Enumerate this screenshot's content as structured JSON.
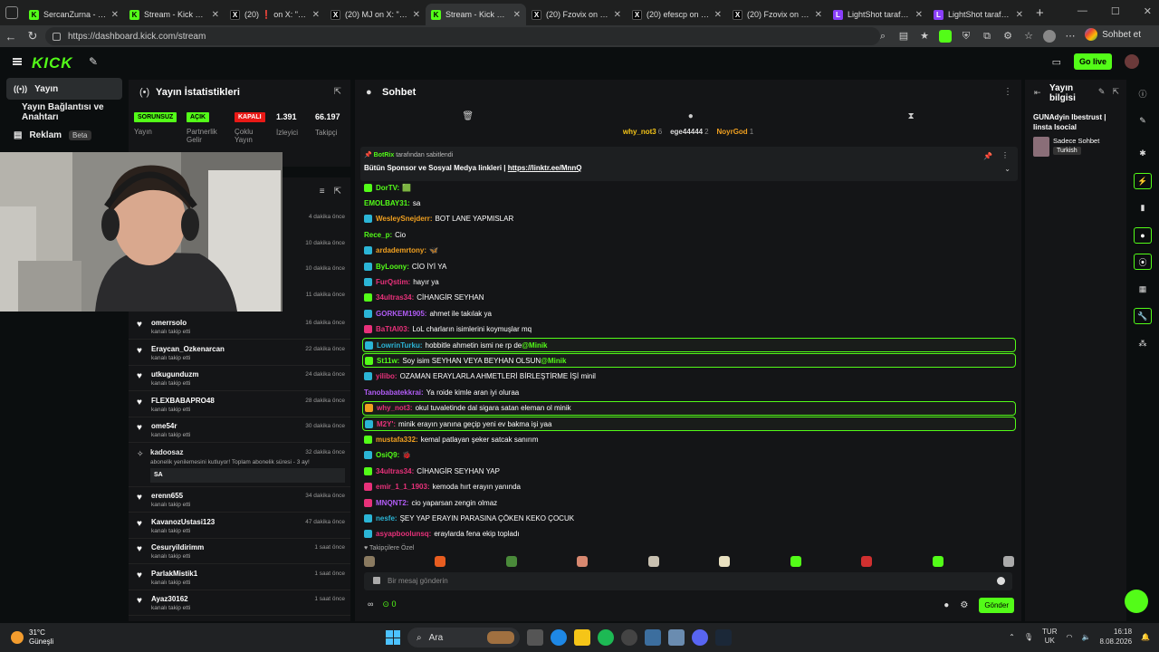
{
  "browser": {
    "tabs": [
      {
        "label": "SercanZurna - Watch",
        "fav": "K",
        "type": "k"
      },
      {
        "label": "Stream - Kick Dashb",
        "fav": "K",
        "type": "k"
      },
      {
        "label": "(20) ❗ on X: \"Raaa",
        "fav": "X",
        "type": "x"
      },
      {
        "label": "(20) MJ on X: \"Selam",
        "fav": "X",
        "type": "x"
      },
      {
        "label": "Stream - Kick Dashb",
        "fav": "K",
        "type": "k",
        "active": true
      },
      {
        "label": "(20) Fzovix on X: \"E",
        "fav": "X",
        "type": "x"
      },
      {
        "label": "(20) efescp on X: \"G",
        "fav": "X",
        "type": "x"
      },
      {
        "label": "(20) Fzovix on X: \"Ka",
        "fav": "X",
        "type": "x"
      },
      {
        "label": "LightShot tarafından",
        "fav": "L",
        "type": "l"
      },
      {
        "label": "LightShot tarafından",
        "fav": "L",
        "type": "l"
      }
    ],
    "url": "https://dashboard.kick.com/stream",
    "profile_label": "Sohbet et",
    "new_tab": "+",
    "win_controls": [
      "—",
      "☐",
      "✕"
    ]
  },
  "header": {
    "logo": "KICK",
    "go_live": "Go live"
  },
  "leftnav": {
    "items": [
      {
        "label": "Yayın",
        "icon": "broadcast-icon"
      },
      {
        "label": "Yayın Bağlantısı ve Anahtarı",
        "icon": ""
      },
      {
        "label": "Reklam",
        "icon": "ad-icon",
        "badge": "Beta"
      }
    ]
  },
  "stats": {
    "title": "Yayın İstatistikleri",
    "items": [
      {
        "badge": "SORUNSUZ",
        "label": "Yayın",
        "color": "#53fc18"
      },
      {
        "badge": "AÇIK",
        "label": "Partnerlik Gelir",
        "color": "#53fc18"
      },
      {
        "badge": "KAPALI",
        "label": "Çoklu Yayın",
        "color": "#e91916"
      },
      {
        "value": "1.391",
        "label": "İzleyici"
      },
      {
        "value": "66.197",
        "label": "Takipçi"
      }
    ]
  },
  "activity": {
    "top_times": [
      "4 dakika önce",
      "10 dakika önce",
      "10 dakika önce",
      "11 dakika önce"
    ],
    "rows": [
      {
        "name": "omerrsolo",
        "sub": "kanalı takip etti",
        "time": "16 dakika önce"
      },
      {
        "name": "Eraycan_Ozkenarcan",
        "sub": "kanalı takip etti",
        "time": "22 dakika önce"
      },
      {
        "name": "utkugunduzm",
        "sub": "kanalı takip etti",
        "time": "24 dakika önce"
      },
      {
        "name": "FLEXBABAPRO48",
        "sub": "kanalı takip etti",
        "time": "28 dakika önce"
      },
      {
        "name": "ome54r",
        "sub": "kanalı takip etti",
        "time": "30 dakika önce"
      }
    ],
    "sub_event": {
      "name": "kadoosaz",
      "sub": "abonelik yenilemesini kutluyor! Toplam abonelik süresi - 3 ay!",
      "msg": "SA",
      "time": "32 dakika önce"
    },
    "rows2": [
      {
        "name": "erenn655",
        "sub": "kanalı takip etti",
        "time": "34 dakika önce"
      },
      {
        "name": "KavanozUstasi123",
        "sub": "kanalı takip etti",
        "time": "47 dakika önce"
      },
      {
        "name": "Cesuryildirimm",
        "sub": "kanalı takip etti",
        "time": "1 saat önce"
      },
      {
        "name": "ParlakMistik1",
        "sub": "kanalı takip etti",
        "time": "1 saat önce"
      },
      {
        "name": "Ayaz30162",
        "sub": "kanalı takip etti",
        "time": "1 saat önce"
      }
    ]
  },
  "chat": {
    "title": "Sohbet",
    "leaders": [
      {
        "name": "why_not3",
        "count": "6"
      },
      {
        "name": "ege44444",
        "count": "2"
      },
      {
        "name": "NoyrGod",
        "count": "1"
      }
    ],
    "pinned_by_user": "BotRix",
    "pinned_by_suffix": "tarafından sabitlendi",
    "pinned_text": "Bütün Sponsor ve Sosyal Medya linkleri |",
    "pinned_link": "https://linktr.ee/MnnQ",
    "messages": [
      {
        "user": "DorTV:",
        "text": "🟩",
        "color": "#53fc18",
        "icon": "#53fc18"
      },
      {
        "user": "EMOLBAY31:",
        "text": "sa",
        "color": "#53fc18",
        "icon": ""
      },
      {
        "user": "WesleySnejderr:",
        "text": "BOT LANE YAPMISLAR",
        "color": "#f0a020",
        "icon": "#2bb5d6"
      },
      {
        "user": "Rece_p:",
        "text": "Cio",
        "color": "#53fc18",
        "icon": ""
      },
      {
        "user": "ardademrtony:",
        "text": "🦋",
        "color": "#f0a020",
        "icon": "#2bb5d6"
      },
      {
        "user": "ByLoony:",
        "text": "CİO İYİ YA",
        "color": "#53fc18",
        "icon": "#2bb5d6"
      },
      {
        "user": "FurQstim:",
        "text": "hayır ya",
        "color": "#e8317a",
        "icon": "#2bb5d6"
      },
      {
        "user": "34ultras34:",
        "text": "CİHANGİR SEYHAN",
        "color": "#e8317a",
        "icon": "#53fc18"
      },
      {
        "user": "GORKEM1905:",
        "text": "ahmet ile takılak ya",
        "color": "#b15cf5",
        "icon": "#2bb5d6"
      },
      {
        "user": "BaTtAl03:",
        "text": "LoL charların isimlerini koymuşlar mq",
        "color": "#e8317a",
        "icon": "#e8317a"
      },
      {
        "user": "LowrinTurku:",
        "text": "hobbitle ahmetin ismi ne rp de ",
        "mention": "@Minik",
        "color": "#2bb5d6",
        "icon": "#2bb5d6",
        "hl": true
      },
      {
        "user": "St11w:",
        "text": "Soy isim SEYHAN VEYA BEYHAN OLSUN ",
        "mention": "@Minik",
        "color": "#53fc18",
        "icon": "#53fc18",
        "hl": true
      },
      {
        "user": "yilibo:",
        "text": "OZAMAN ERAYLARLA AHMETLERİ BİRLEŞTİRME İŞİ minil",
        "color": "#e8317a",
        "icon": "#2bb5d6"
      },
      {
        "user": "Tanobabatekkrai:",
        "text": "Ya roide kimle aran iyi oluraa",
        "color": "#b15cf5",
        "icon": ""
      },
      {
        "user": "why_not3:",
        "text": "okul tuvaletinde dal sigara satan eleman ol minik",
        "color": "#e8317a",
        "icon": "#f0a020",
        "hl": true
      },
      {
        "user": "M2Y':",
        "text": "minik erayın yanına geçip yeni ev bakma işi yaa",
        "color": "#e8317a",
        "icon": "#2bb5d6",
        "hl": true
      },
      {
        "user": "mustafa332:",
        "text": "kemal patlayan şeker satcak sanırım",
        "color": "#f0a020",
        "icon": "#53fc18"
      },
      {
        "user": "OsiQ9:",
        "text": "🐞",
        "color": "#53fc18",
        "icon": "#2bb5d6"
      },
      {
        "user": "34ultras34:",
        "text": "CİHANGİR SEYHAN YAP",
        "color": "#e8317a",
        "icon": "#53fc18"
      },
      {
        "user": "emir_1_1_1903:",
        "text": "kemoda hırt erayın yanında",
        "color": "#e8317a",
        "icon": "#e8317a"
      },
      {
        "user": "MNQNT2:",
        "text": "cio yaparsan zengin olmaz",
        "color": "#b15cf5",
        "icon": "#e8317a"
      },
      {
        "user": "nesfe:",
        "text": "ŞEY YAP ERAYIN PARASINA ÇÖKEN KEKO ÇOCUK",
        "color": "#2bb5d6",
        "icon": "#2bb5d6"
      },
      {
        "user": "asyapboolunsq:",
        "text": "eraylarda fena ekip topladı",
        "color": "#e8317a",
        "icon": "#2bb5d6"
      }
    ],
    "fan_label": "♥ Takipçilere Özel",
    "input_placeholder": "Bir mesaj gönderin",
    "bottom_left": "∞",
    "bottom_count": "0",
    "send_label": "Gönder"
  },
  "info": {
    "title": "Yayın bilgisi",
    "stream_title": "GUNAdyin Ibestrust | Iinsta Isocial",
    "chat_type": "Sadece Sohbet",
    "language": "Turkish"
  },
  "taskbar": {
    "temp": "31°C",
    "weather": "Güneşli",
    "search": "Ara",
    "lang1": "TUR",
    "lang2": "UK",
    "time": "16:18",
    "date": "8.08.2026"
  }
}
